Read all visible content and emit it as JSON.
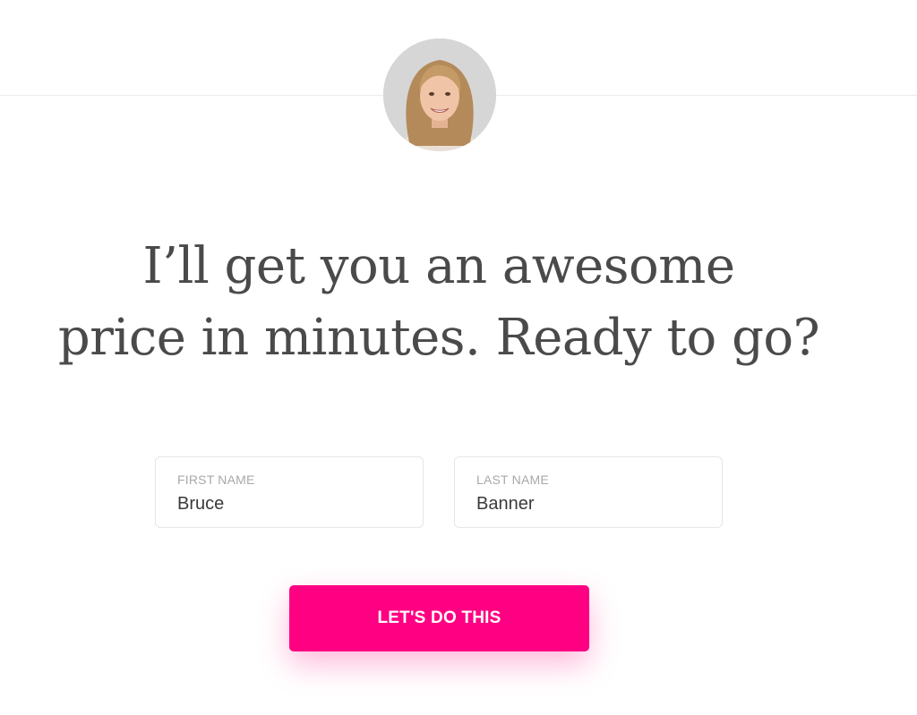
{
  "agent": {
    "avatar_icon": "agent-avatar-photo"
  },
  "headline": {
    "line1": "I’ll get you an awesome",
    "line2": "price in minutes. Ready to go?"
  },
  "form": {
    "first_name": {
      "label": "FIRST NAME",
      "value": "Bruce"
    },
    "last_name": {
      "label": "LAST NAME",
      "value": "Banner"
    },
    "submit_label": "LET'S DO THIS"
  },
  "colors": {
    "accent": "#ff0083",
    "headline_text": "#4a4a4a",
    "label_text": "#a8a8a8",
    "divider": "#ececec"
  }
}
